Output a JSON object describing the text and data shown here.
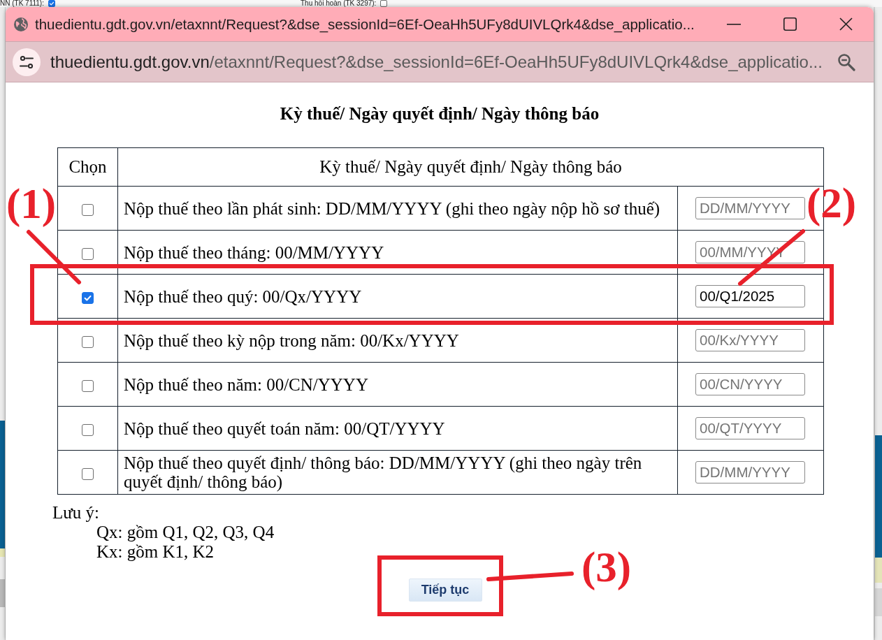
{
  "background_page": {
    "fields": [
      {
        "label": "NN (TK 7111):",
        "checked": true
      },
      {
        "label": "Thu hồi hoàn (TK 3297):",
        "checked": false
      }
    ]
  },
  "popup": {
    "title_bar": {
      "title": "thuedientu.gdt.gov.vn/etaxnnt/Request?&dse_sessionId=6Ef-OeaHh5UFy8dUIVLQrk4&dse_applicatio..."
    },
    "address_bar": {
      "domain": "thuedientu.gdt.gov.vn",
      "path": "/etaxnnt/Request?&dse_sessionId=6Ef-OeaHh5UFy8dUIVLQrk4&dse_applicatio..."
    },
    "heading": "Kỳ thuế/ Ngày quyết định/ Ngày thông báo",
    "table": {
      "columns": [
        "Chọn",
        "Kỳ thuế/ Ngày quyết định/ Ngày thông báo"
      ],
      "rows": [
        {
          "label": "Nộp thuế theo lần phát sinh: DD/MM/YYYY (ghi theo ngày nộp hồ sơ thuế)",
          "checked": false,
          "placeholder": "DD/MM/YYYY"
        },
        {
          "label": "Nộp thuế theo tháng: 00/MM/YYYY",
          "checked": false,
          "placeholder": "00/MM/YYYY"
        },
        {
          "label": "Nộp thuế theo quý: 00/Qx/YYYY",
          "checked": true,
          "value": "00/Q1/2025"
        },
        {
          "label": "Nộp thuế theo kỳ nộp trong năm: 00/Kx/YYYY",
          "checked": false,
          "placeholder": "00/Kx/YYYY"
        },
        {
          "label": "Nộp thuế theo năm: 00/CN/YYYY",
          "checked": false,
          "placeholder": "00/CN/YYYY"
        },
        {
          "label": "Nộp thuế theo quyết toán năm: 00/QT/YYYY",
          "checked": false,
          "placeholder": "00/QT/YYYY"
        },
        {
          "label": "Nộp thuế theo quyết định/ thông báo: DD/MM/YYYY (ghi theo ngày trên quyết định/ thông báo)",
          "checked": false,
          "placeholder": "DD/MM/YYYY"
        }
      ]
    },
    "note": {
      "title": "Lưu ý:",
      "lines": [
        "Qx: gồm Q1, Q2, Q3, Q4",
        "Kx: gồm K1, K2"
      ]
    },
    "continue_button": "Tiếp tục"
  },
  "annotations": [
    {
      "label": "(1)"
    },
    {
      "label": "(2)"
    },
    {
      "label": "(3)"
    }
  ]
}
